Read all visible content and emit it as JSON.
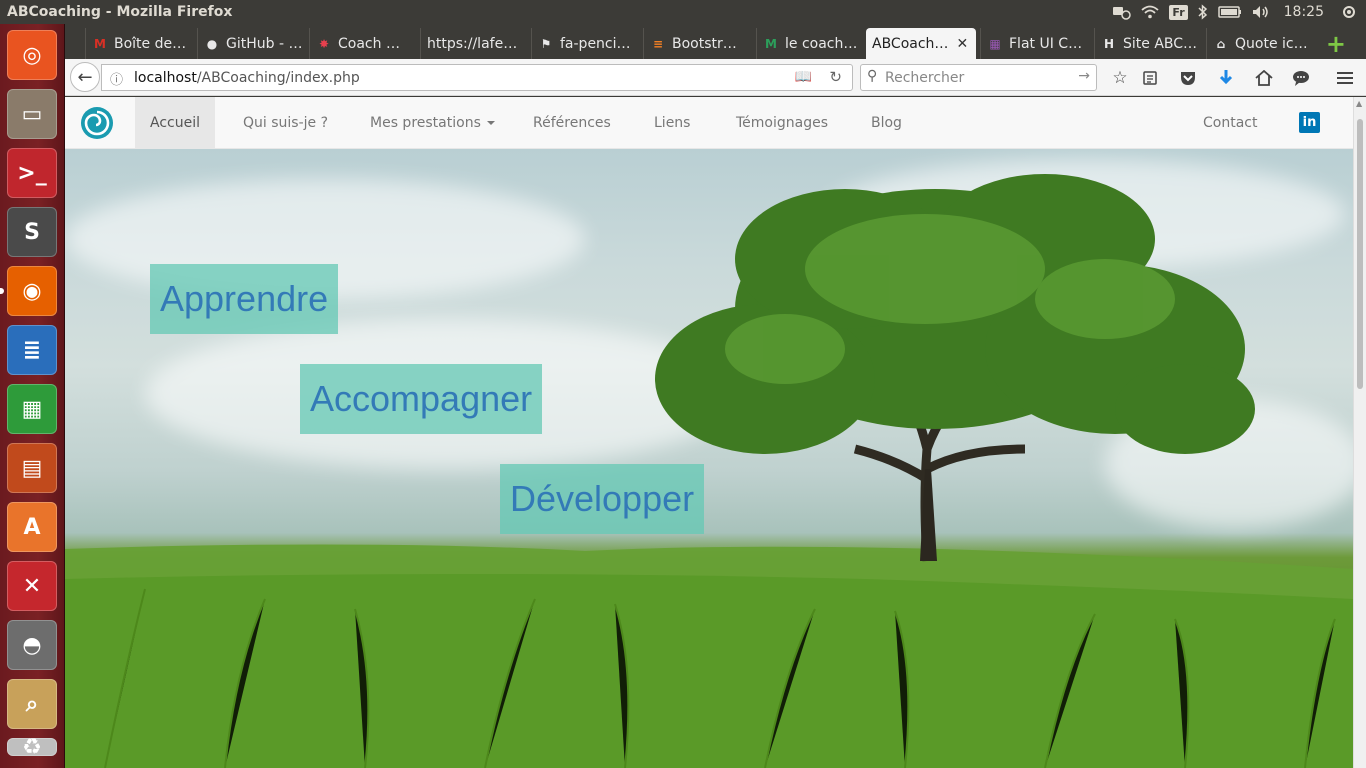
{
  "os": {
    "window_title": "ABCoaching - Mozilla Firefox",
    "keyboard_layout": "Fr",
    "clock": "18:25",
    "launcher_items": [
      {
        "name": "ubuntu-dash",
        "color": "#e95420"
      },
      {
        "name": "files",
        "color": "#8a7b6a"
      },
      {
        "name": "terminal",
        "color": "#c0262d"
      },
      {
        "name": "sublime-text",
        "color": "#4a4a4a"
      },
      {
        "name": "firefox",
        "color": "#e66000"
      },
      {
        "name": "libreoffice-writer",
        "color": "#2a6ebb"
      },
      {
        "name": "libreoffice-calc",
        "color": "#2e9b3a"
      },
      {
        "name": "libreoffice-impress",
        "color": "#c14a1c"
      },
      {
        "name": "software-center",
        "color": "#e9742b"
      },
      {
        "name": "system-settings",
        "color": "#c5272d"
      },
      {
        "name": "gimp",
        "color": "#6d6d6d"
      },
      {
        "name": "image-viewer",
        "color": "#c8a15a"
      },
      {
        "name": "trash",
        "color": "#bfbfbf"
      }
    ]
  },
  "browser": {
    "tabs": [
      {
        "label": "Boîte de…",
        "icon": "gmail-icon",
        "icon_color": "#d93025",
        "icon_char": "M"
      },
      {
        "label": "GitHub - …",
        "icon": "github-icon",
        "icon_color": "#e8e8e8",
        "icon_char": "●"
      },
      {
        "label": "Coach …",
        "icon": "star-icon",
        "icon_color": "#e8404e",
        "icon_char": "✸"
      },
      {
        "label": "https://lafe…",
        "icon": "",
        "icon_color": "",
        "icon_char": ""
      },
      {
        "label": "fa-penci…",
        "icon": "flag-icon",
        "icon_color": "#e8e8e8",
        "icon_char": "⚑"
      },
      {
        "label": "Bootstr…",
        "icon": "stackoverflow-icon",
        "icon_color": "#f48024",
        "icon_char": "≡"
      },
      {
        "label": "le coach…",
        "icon": "bookmark-icon",
        "icon_color": "#2c9f5b",
        "icon_char": "M"
      },
      {
        "label": "ABCoach…",
        "icon": "",
        "icon_color": "",
        "icon_char": "",
        "active": true
      },
      {
        "label": "Flat UI C…",
        "icon": "grid-icon",
        "icon_color": "#9b59b6",
        "icon_char": "▦"
      },
      {
        "label": "Site ABC…",
        "icon": "h-icon",
        "icon_color": "#e8e8e8",
        "icon_char": "H"
      },
      {
        "label": "Quote ic…",
        "icon": "quote-icon",
        "icon_color": "#e8e8e8",
        "icon_char": "⌂"
      }
    ],
    "url_host": "localhost",
    "url_path": "/ABCoaching/index.php",
    "search_placeholder": "Rechercher"
  },
  "site": {
    "nav": {
      "links": [
        {
          "label": "Accueil",
          "active": true
        },
        {
          "label": "Qui suis-je ?"
        },
        {
          "label": "Mes prestations",
          "dropdown": true
        },
        {
          "label": "Références"
        },
        {
          "label": "Liens"
        },
        {
          "label": "Témoignages"
        },
        {
          "label": "Blog"
        }
      ],
      "contact": "Contact",
      "linkedin": "in"
    },
    "hero": {
      "words": [
        "Apprendre",
        "Accompagner",
        "Développer"
      ]
    }
  },
  "colors": {
    "ubuntu_panel": "#3c3b37",
    "launcher": "#7a2124",
    "link_blue": "#337ab7",
    "hero_box": "#64c8b4",
    "linkedin": "#0077b5"
  }
}
